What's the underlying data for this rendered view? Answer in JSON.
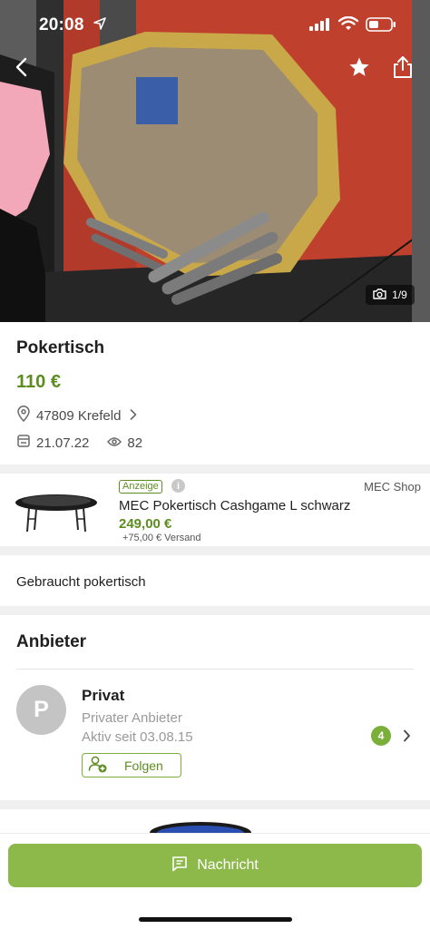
{
  "status_bar": {
    "time": "20:08"
  },
  "gallery": {
    "counter": "1/9"
  },
  "listing": {
    "title": "Pokertisch",
    "price": "110 €",
    "location": "47809 Krefeld",
    "date": "21.07.22",
    "views": "82"
  },
  "ad": {
    "badge": "Anzeige",
    "info": "i",
    "shop": "MEC Shop",
    "title": "MEC Pokertisch Cashgame L schwarz",
    "price": "249,00 €",
    "shipping": "+75,00 € Versand"
  },
  "description": "Gebraucht pokertisch",
  "seller_section": {
    "title": "Anbieter",
    "avatar_letter": "P",
    "name": "Privat",
    "type": "Privater Anbieter",
    "active_since": "Aktiv seit 03.08.15",
    "listing_count": "4",
    "follow_label": "Folgen"
  },
  "bottom_bar": {
    "message_label": "Nachricht"
  },
  "colors": {
    "brand_green": "#5d8c21",
    "button_green": "#8db84a",
    "badge_green": "#7ab03a"
  },
  "icons": [
    "back-arrow-icon",
    "star-icon",
    "share-icon",
    "camera-icon",
    "location-pin-icon",
    "chevron-right-icon",
    "calendar-icon",
    "eye-icon",
    "info-icon",
    "follow-person-icon",
    "chat-icon",
    "location-arrow-icon",
    "signal-icon",
    "wifi-icon",
    "battery-icon"
  ]
}
